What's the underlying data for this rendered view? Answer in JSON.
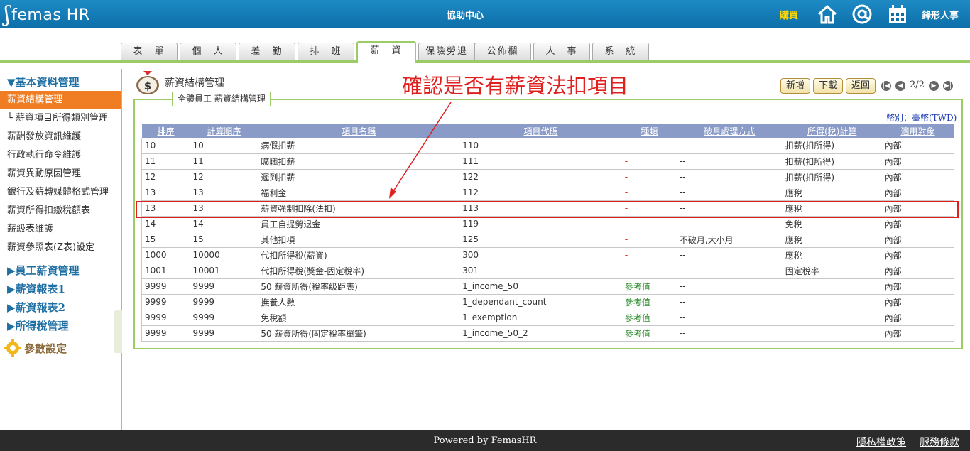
{
  "header": {
    "logo_text": "femas HR",
    "help_center": "協助中心",
    "buy": "購買",
    "user_name": "鋒形人事"
  },
  "tabs": [
    {
      "label": "表　單"
    },
    {
      "label": "個　人"
    },
    {
      "label": "差　勤"
    },
    {
      "label": "排　班"
    },
    {
      "label": "薪　資"
    },
    {
      "label": "保險勞退"
    },
    {
      "label": "公佈欄"
    },
    {
      "label": "人　事"
    },
    {
      "label": "系　統"
    }
  ],
  "sidebar": {
    "group_basic": "▼基本資料管理",
    "items": [
      {
        "label": "薪資結構管理"
      },
      {
        "label": "└ 薪資項目所得類別管理"
      },
      {
        "label": "薪酬發放資訊維護"
      },
      {
        "label": "行政執行命令維護"
      },
      {
        "label": "薪資異動原因管理"
      },
      {
        "label": "銀行及薪轉媒體格式管理"
      },
      {
        "label": "薪資所得扣繳稅額表"
      },
      {
        "label": "薪級表維護"
      },
      {
        "label": "薪資參照表(Z表)設定"
      }
    ],
    "group_employee": "▶員工薪資管理",
    "group_report1": "▶薪資報表1",
    "group_report2": "▶薪資報表2",
    "group_tax": "▶所得稅管理",
    "settings": "參數設定"
  },
  "main": {
    "page_title": "薪資結構管理",
    "annotation": "確認是否有薪資法扣項目",
    "btn_add": "新增",
    "btn_download": "下載",
    "btn_back": "返回",
    "page_indicator": "2/2",
    "panel_legend": "全體員工 薪資結構管理",
    "currency": "幣別：臺幣(TWD)",
    "columns": [
      "排序",
      "計算順序",
      "項目名稱",
      "項目代碼",
      "種類",
      "破月處理方式",
      "所得(稅)計算",
      "適用對象"
    ]
  },
  "rows": [
    [
      "10",
      "10",
      "病假扣薪",
      "110",
      "-",
      "--",
      "扣薪(扣所得)",
      "內部"
    ],
    [
      "11",
      "11",
      "曠職扣薪",
      "111",
      "-",
      "--",
      "扣薪(扣所得)",
      "內部"
    ],
    [
      "12",
      "12",
      "遲到扣薪",
      "122",
      "-",
      "--",
      "扣薪(扣所得)",
      "內部"
    ],
    [
      "13",
      "13",
      "福利金",
      "112",
      "-",
      "--",
      "應稅",
      "內部"
    ],
    [
      "13",
      "13",
      "薪資強制扣除(法扣)",
      "113",
      "-",
      "--",
      "應稅",
      "內部"
    ],
    [
      "14",
      "14",
      "員工自提勞退金",
      "119",
      "-",
      "--",
      "免稅",
      "內部"
    ],
    [
      "15",
      "15",
      "其他扣項",
      "125",
      "-",
      "不破月,大小月",
      "應稅",
      "內部"
    ],
    [
      "1000",
      "10000",
      "代扣所得稅(薪資)",
      "300",
      "-",
      "--",
      "應稅",
      "內部"
    ],
    [
      "1001",
      "10001",
      "代扣所得稅(獎金-固定稅率)",
      "301",
      "-",
      "--",
      "固定稅率",
      "內部"
    ],
    [
      "9999",
      "9999",
      "50 薪資所得(稅率級距表)",
      "1_income_50",
      "參考值",
      "--",
      "",
      "內部"
    ],
    [
      "9999",
      "9999",
      "撫養人數",
      "1_dependant_count",
      "參考值",
      "--",
      "",
      "內部"
    ],
    [
      "9999",
      "9999",
      "免稅額",
      "1_exemption",
      "參考值",
      "--",
      "",
      "內部"
    ],
    [
      "9999",
      "9999",
      "50 薪資所得(固定稅率單筆)",
      "1_income_50_2",
      "參考值",
      "--",
      "",
      "內部"
    ]
  ],
  "footer": {
    "powered_prefix": "Powered by ",
    "powered_link": "FemasHR",
    "privacy": "隱私權政策",
    "terms": "服務條款"
  },
  "colors": {
    "header_blue": "#0c6fa9",
    "accent_green": "#9ccc65",
    "active_orange": "#f07d23",
    "annotation_red": "#e0201e",
    "table_header": "#8b9bc7"
  }
}
